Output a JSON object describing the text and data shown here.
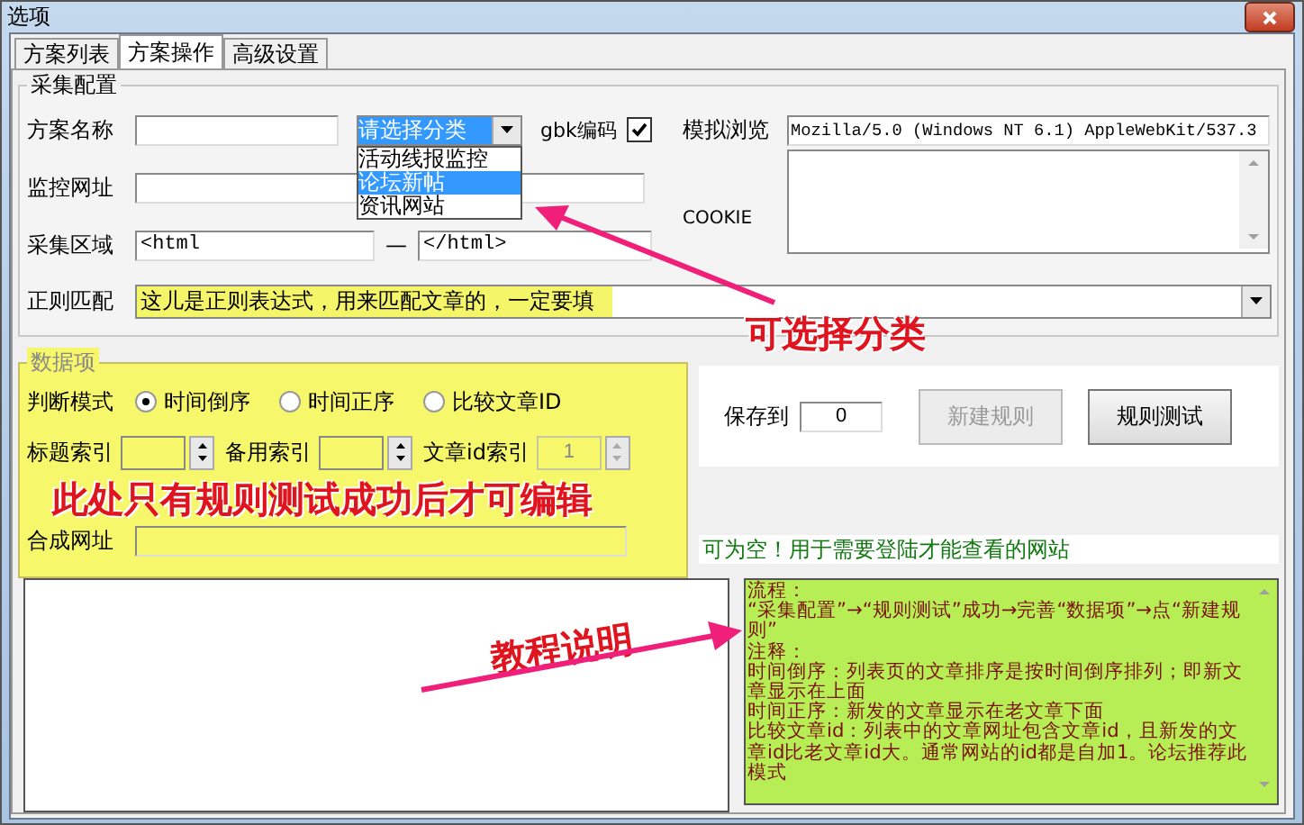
{
  "window": {
    "title": "选项"
  },
  "tabs": [
    {
      "label": "方案列表",
      "selected": false
    },
    {
      "label": "方案操作",
      "selected": true
    },
    {
      "label": "高级设置",
      "selected": false
    }
  ],
  "capture_config": {
    "legend": "采集配置",
    "name_label": "方案名称",
    "category": {
      "value": "请选择分类",
      "expanded": true,
      "options": [
        {
          "label": "活动线报监控",
          "selected": false
        },
        {
          "label": "论坛新帖",
          "selected": true
        },
        {
          "label": "资讯网站",
          "selected": false
        }
      ]
    },
    "gbk": {
      "label": "gbk编码",
      "checked": true
    },
    "ua": {
      "label": "模拟浏览",
      "value": "Mozilla/5.0 (Windows NT 6.1) AppleWebKit/537.3"
    },
    "url_label": "监控网址",
    "cookie_label": "COOKIE",
    "range": {
      "label": "采集区域",
      "start": "<html",
      "separator": "—",
      "end": "</html>"
    },
    "regex": {
      "label": "正则匹配",
      "value": "这儿是正则表达式，用来匹配文章的，一定要填"
    }
  },
  "data_items": {
    "legend": "数据项",
    "mode_label": "判断模式",
    "modes": [
      {
        "label": "时间倒序",
        "selected": true
      },
      {
        "label": "时间正序",
        "selected": false
      },
      {
        "label": "比较文章ID",
        "selected": false
      }
    ],
    "indexes": [
      {
        "label": "标题索引",
        "disabled": false
      },
      {
        "label": "备用索引",
        "disabled": false
      },
      {
        "label": "文章id索引",
        "value": "1",
        "disabled": true
      }
    ],
    "compose_label": "合成网址"
  },
  "actions": {
    "save_label": "保存到",
    "save_value": "0",
    "buttons": [
      {
        "label": "新建规则",
        "disabled": true
      },
      {
        "label": "规则测试",
        "disabled": false
      }
    ]
  },
  "cookie_hint": "可为空！用于需要登陆才能查看的网站",
  "tutorial": {
    "paragraphs": [
      "流程：",
      "“采集配置”→“规则测试”成功→完善“数据项”→点“新建规则”",
      "注释：",
      "时间倒序：列表页的文章排序是按时间倒序排列；即新文章显示在上面",
      "时间正序：新发的文章显示在老文章下面",
      "比较文章id：列表中的文章网址包含文章id，且新发的文章id比老文章id大。通常网站的id都是自加1。论坛推荐此模式"
    ]
  },
  "annotations": {
    "category_note": "可选择分类",
    "edit_note": "此处只有规则测试成功后才可编辑",
    "tutorial_note": "教程说明"
  }
}
